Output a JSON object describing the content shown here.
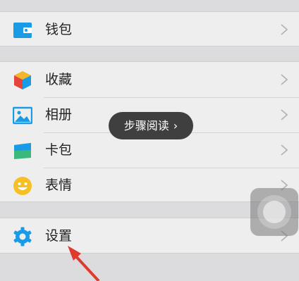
{
  "menu": {
    "wallet": {
      "label": "钱包",
      "icon": "wallet-icon"
    },
    "favorites": {
      "label": "收藏",
      "icon": "favorites-cube-icon"
    },
    "album": {
      "label": "相册",
      "icon": "album-picture-icon"
    },
    "cards": {
      "label": "卡包",
      "icon": "card-pack-icon"
    },
    "stickers": {
      "label": "表情",
      "icon": "smiley-icon"
    },
    "settings": {
      "label": "设置",
      "icon": "gear-icon"
    }
  },
  "tooltip": {
    "text": "步骤阅读",
    "icon": "chevron-right-icon"
  },
  "colors": {
    "accent_blue": "#1a9be6",
    "annotation_red": "#e03a2f"
  }
}
